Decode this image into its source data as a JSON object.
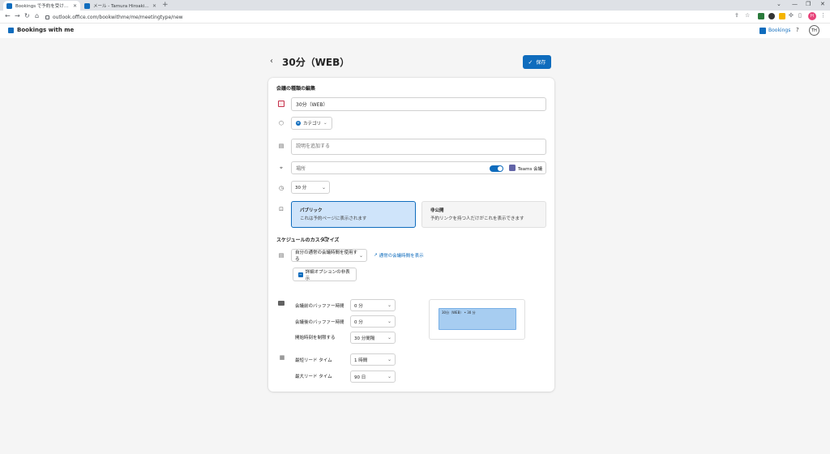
{
  "browser": {
    "tabs": [
      {
        "label": "Bookings で予約を受ける - Tamura"
      },
      {
        "label": "メール - Tamura Hiroaki - Outlook"
      }
    ],
    "url": "outlook.office.com/bookwithme/me/meetingtype/new",
    "profile_initial": "H"
  },
  "app": {
    "name": "Bookings with me",
    "bookings_link": "Bookings",
    "help": "?",
    "avatar_initials": "TH"
  },
  "page": {
    "title": "30分（WEB）",
    "save_label": "保存"
  },
  "form": {
    "section_title": "会議の種類の編集",
    "name_value": "30分（WEB）",
    "category_label": "カテゴリ",
    "description_placeholder": "説明を追加する",
    "location_placeholder": "場所",
    "teams_label": "Teams 会議",
    "duration_value": "30 分",
    "visibility": {
      "public_title": "パブリック",
      "public_desc": "これは予約ページに表示されます",
      "private_title": "非公開",
      "private_desc": "予約リンクを持つ人だけがこれを表示できます"
    }
  },
  "schedule": {
    "section_title": "スケジュールのカスタマイズ",
    "hours_value": "自分の通常の会議時間を使用する",
    "show_hours_link": "通常の会議時間を表示",
    "advanced_toggle_label": "詳細オプションの非表示",
    "buffer_before_label": "会議前のバッファー時間",
    "buffer_before_value": "0 分",
    "buffer_after_label": "会議後のバッファー時間",
    "buffer_after_value": "0 分",
    "start_limit_label": "開始時刻を制限する",
    "start_limit_value": "30 分間隔",
    "min_lead_label": "最短リード タイム",
    "min_lead_value": "1 時間",
    "max_lead_label": "最大リード タイム",
    "max_lead_value": "90 日",
    "preview_text": "30分（WEB） • 30 分"
  },
  "colors": {
    "accent": "#0f6cbd",
    "selected_bg": "#cfe4fa",
    "preview_slot": "#a7cdf1"
  }
}
